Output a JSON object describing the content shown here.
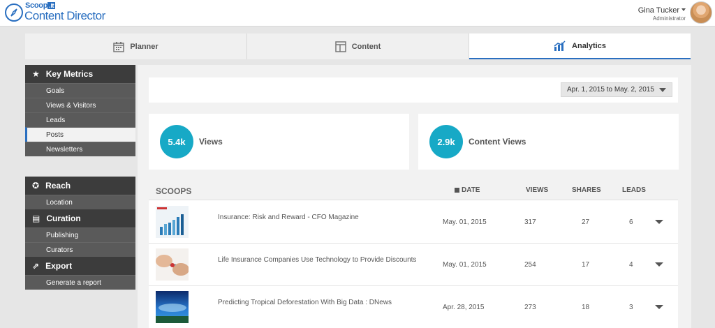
{
  "header": {
    "brand": "Scoop",
    "brand_it": ".it",
    "product": "Content Director",
    "user_name": "Gina Tucker",
    "user_role": "Administrator"
  },
  "tabs": [
    {
      "label": "Planner",
      "icon": "calendar-icon"
    },
    {
      "label": "Content",
      "icon": "layout-icon"
    },
    {
      "label": "Analytics",
      "icon": "bar-chart-icon",
      "active": true
    }
  ],
  "sidebar": {
    "key_metrics": {
      "label": "Key Metrics",
      "items": [
        "Goals",
        "Views & Visitors",
        "Leads",
        "Posts",
        "Newsletters"
      ],
      "active": "Posts"
    },
    "reach": {
      "label": "Reach",
      "items": [
        "Location"
      ]
    },
    "curation": {
      "label": "Curation",
      "items": [
        "Publishing",
        "Curators"
      ]
    },
    "export": {
      "label": "Export",
      "items": [
        "Generate a report"
      ]
    }
  },
  "date_range": "Apr. 1, 2015 to May. 2, 2015",
  "metrics": [
    {
      "value": "5.4k",
      "label": "Views"
    },
    {
      "value": "2.9k",
      "label": "Content Views"
    }
  ],
  "scoops": {
    "title": "SCOOPS",
    "columns": {
      "date": "DATE",
      "views": "VIEWS",
      "shares": "SHARES",
      "leads": "LEADS"
    },
    "rows": [
      {
        "title": "Insurance: Risk and Reward - CFO Magazine",
        "date": "May. 01, 2015",
        "views": "317",
        "shares": "27",
        "leads": "6"
      },
      {
        "title": "Life Insurance Companies Use Technology to Provide Discounts",
        "date": "May. 01, 2015",
        "views": "254",
        "shares": "17",
        "leads": "4"
      },
      {
        "title": "Predicting Tropical Deforestation With Big Data : DNews",
        "date": "Apr. 28, 2015",
        "views": "273",
        "shares": "18",
        "leads": "3"
      }
    ]
  },
  "colors": {
    "accent": "#2a6fc0",
    "bubble": "#17a9c6",
    "sidebar_dark": "#3c3c3c",
    "sidebar_item": "#5a5a5a"
  }
}
